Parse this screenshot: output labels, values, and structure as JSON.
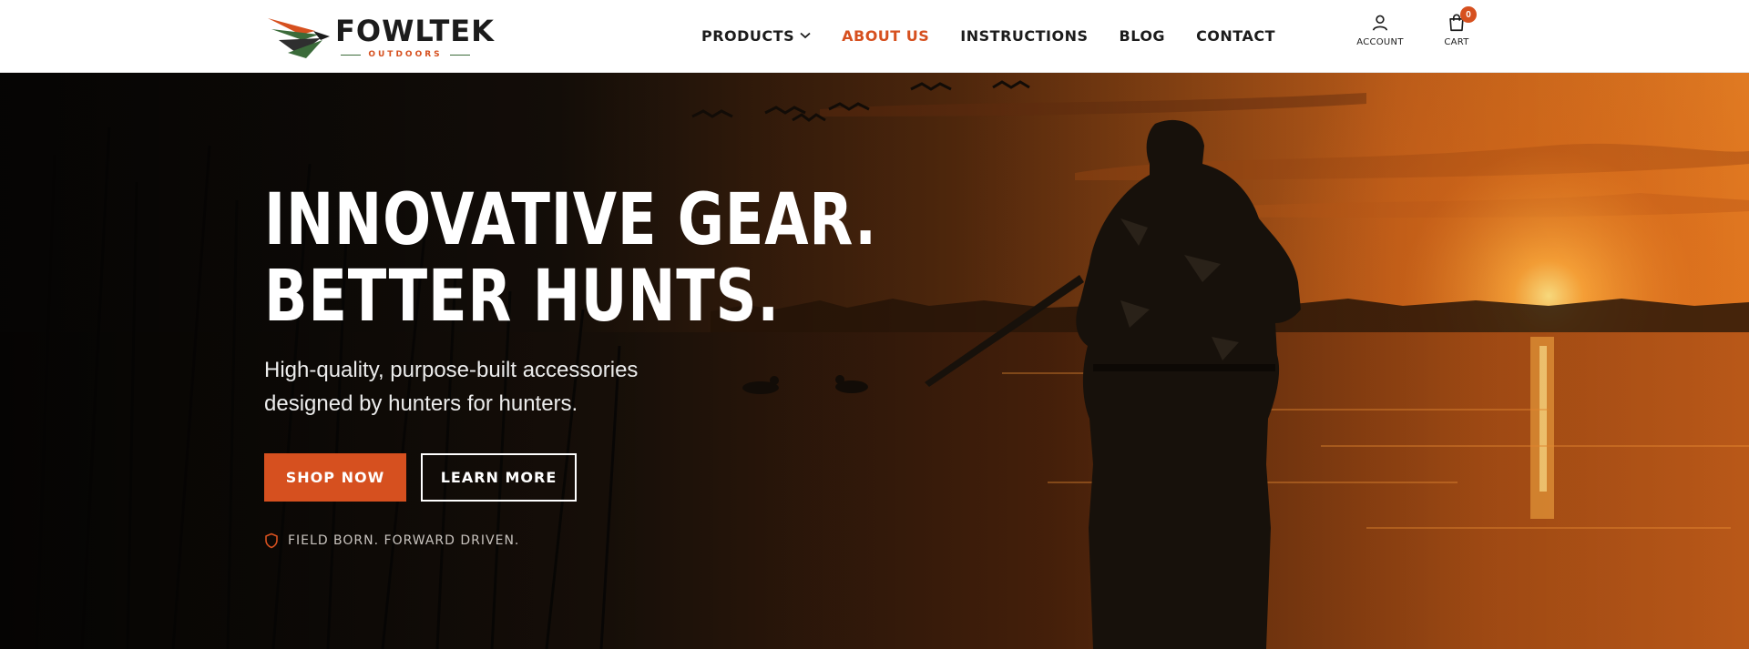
{
  "brand": {
    "name": "FOWLTEK",
    "sub": "OUTDOORS",
    "colors": {
      "accent": "#d6501f",
      "green": "#3b6b3a",
      "ink": "#1c1c1c"
    }
  },
  "nav": {
    "items": [
      {
        "label": "PRODUCTS",
        "has_dropdown": true
      },
      {
        "label": "ABOUT US",
        "active": true
      },
      {
        "label": "INSTRUCTIONS"
      },
      {
        "label": "BLOG"
      },
      {
        "label": "CONTACT"
      }
    ]
  },
  "utils": {
    "account": {
      "label": "ACCOUNT",
      "icon": "user-icon"
    },
    "cart": {
      "label": "CART",
      "icon": "shopping-bag-icon",
      "count": "0"
    }
  },
  "hero": {
    "headline_line1": "INNOVATIVE GEAR.",
    "headline_line2": "BETTER HUNTS.",
    "subhead_line1": "High-quality, purpose-built accessories",
    "subhead_line2": "designed by hunters for hunters.",
    "primary_button": "SHOP NOW",
    "secondary_button": "LEARN MORE",
    "tagline": "FIELD BORN. FORWARD DRIVEN.",
    "tagline_icon": "shield-icon"
  }
}
